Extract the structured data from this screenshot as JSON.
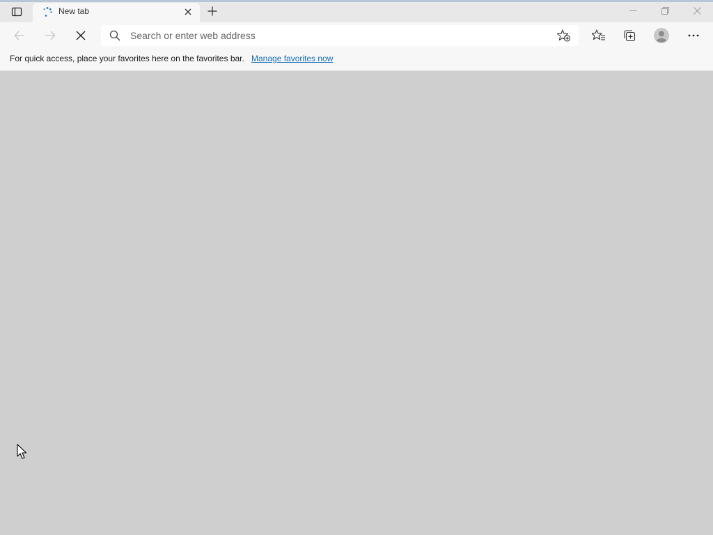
{
  "tab": {
    "title": "New tab"
  },
  "address": {
    "placeholder": "Search or enter web address",
    "value": ""
  },
  "favorites_bar": {
    "message": "For quick access, place your favorites here on the favorites bar.",
    "link": "Manage favorites now"
  },
  "colors": {
    "content_bg": "#cfcfcf",
    "link": "#1a6db5",
    "spinner": "#1a73c4"
  },
  "icons": {
    "tab_actions": "tab-actions-icon",
    "tab_spinner": "loading-spinner-icon",
    "tab_close": "close-icon",
    "new_tab": "plus-icon",
    "back": "arrow-left-icon",
    "forward": "arrow-right-icon",
    "stop": "stop-x-icon",
    "search": "search-icon",
    "add_favorite": "star-plus-icon",
    "favorites": "favorites-star-list-icon",
    "collections": "collections-icon",
    "profile": "avatar-icon",
    "menu": "more-dots-icon"
  }
}
